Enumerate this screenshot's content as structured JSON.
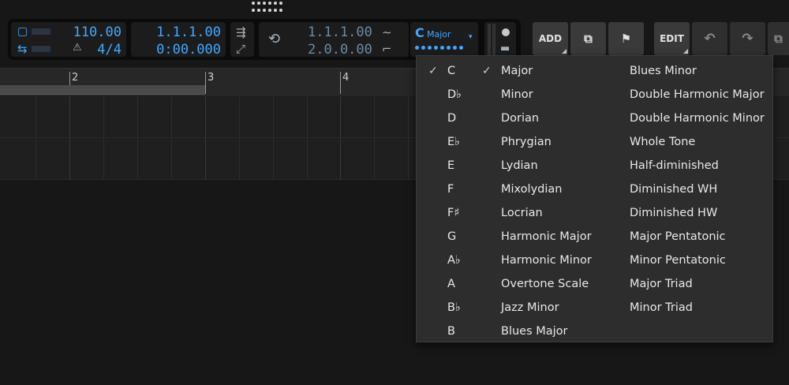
{
  "transport": {
    "tempo": "110.00",
    "time_signature": "4/4",
    "position_beats": "1.1.1.00",
    "position_time": "0:00.000",
    "loop_start": "1.1.1.00",
    "loop_end": "2.0.0.00",
    "key_root": "C",
    "key_scale": "Major"
  },
  "toolbar": {
    "add_label": "ADD",
    "edit_label": "EDIT"
  },
  "ruler": {
    "bar2": "2",
    "bar3": "3",
    "bar4": "4"
  },
  "key_menu": {
    "roots": [
      "C",
      "D♭",
      "D",
      "E♭",
      "E",
      "F",
      "F♯",
      "G",
      "A♭",
      "A",
      "B♭",
      "B"
    ],
    "selected_root": "C",
    "scales_col1": [
      "Major",
      "Minor",
      "Dorian",
      "Phrygian",
      "Lydian",
      "Mixolydian",
      "Locrian",
      "Harmonic Major",
      "Harmonic Minor",
      "Overtone Scale",
      "Jazz Minor",
      "Blues Major"
    ],
    "scales_col2": [
      "Blues Minor",
      "Double Harmonic Major",
      "Double Harmonic Minor",
      "Whole Tone",
      "Half-diminished",
      "Diminished WH",
      "Diminished HW",
      "Major Pentatonic",
      "Minor Pentatonic",
      "Major Triad",
      "Minor Triad"
    ],
    "selected_scale": "Major"
  },
  "icons": {
    "check": "✓"
  }
}
